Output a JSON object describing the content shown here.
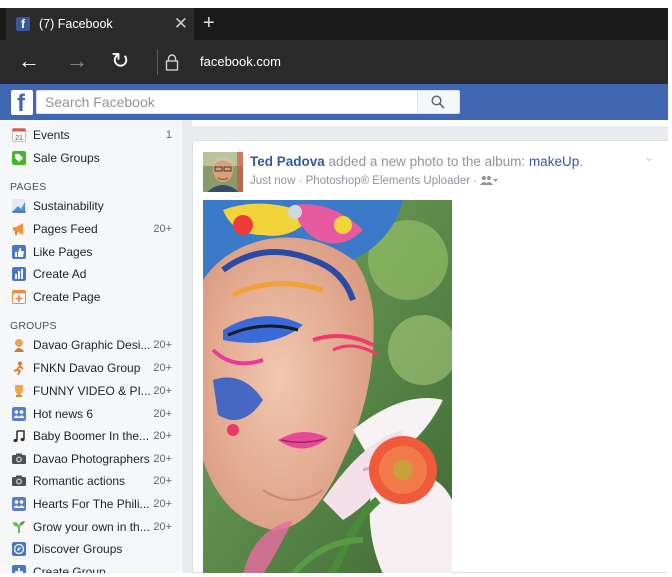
{
  "browser": {
    "tab_title": "(7) Facebook",
    "tab_close": "✕",
    "new_tab": "+",
    "url": "facebook.com",
    "back": "←",
    "forward": "→",
    "refresh": "↻"
  },
  "header": {
    "logo": "f",
    "search_placeholder": "Search Facebook",
    "brand_color": "#4267b2"
  },
  "sidebar": {
    "top_items": [
      {
        "label": "Events",
        "count": "1",
        "icon": "calendar-icon",
        "icon_text": "21"
      },
      {
        "label": "Sale Groups",
        "count": "",
        "icon": "sale-groups-icon"
      }
    ],
    "pages_heading": "PAGES",
    "pages_items": [
      {
        "label": "Sustainability",
        "count": "",
        "icon": "sustainability-icon"
      },
      {
        "label": "Pages Feed",
        "count": "20+",
        "icon": "megaphone-icon"
      },
      {
        "label": "Like Pages",
        "count": "",
        "icon": "thumbs-up-icon"
      },
      {
        "label": "Create Ad",
        "count": "",
        "icon": "bar-chart-icon"
      },
      {
        "label": "Create Page",
        "count": "",
        "icon": "plus-flag-icon"
      }
    ],
    "groups_heading": "GROUPS",
    "groups_items": [
      {
        "label": "Davao Graphic Desi...",
        "count": "20+",
        "icon": "group-avatar-icon"
      },
      {
        "label": "FNKN Davao Group",
        "count": "20+",
        "icon": "figure-icon"
      },
      {
        "label": "FUNNY VIDEO & PI...",
        "count": "20+",
        "icon": "trophy-icon"
      },
      {
        "label": "Hot news 6",
        "count": "20+",
        "icon": "group-people-icon"
      },
      {
        "label": "Baby Boomer In the...",
        "count": "20+",
        "icon": "music-note-icon"
      },
      {
        "label": "Davao Photographers",
        "count": "20+",
        "icon": "camera-icon"
      },
      {
        "label": "Romantic actions",
        "count": "20+",
        "icon": "camera-icon"
      },
      {
        "label": "Hearts For The Phili...",
        "count": "20+",
        "icon": "group-people-icon"
      },
      {
        "label": "Grow your own in th...",
        "count": "20+",
        "icon": "sprout-icon"
      },
      {
        "label": "Discover Groups",
        "count": "",
        "icon": "compass-icon"
      },
      {
        "label": "Create Group",
        "count": "",
        "icon": "create-group-icon"
      }
    ]
  },
  "post": {
    "author": "Ted Padova",
    "action": " added a new photo to the album: ",
    "album": "makeUp",
    "period": ".",
    "time": "Just now",
    "separator": " · ",
    "app": "Photoshop® Elements Uploader",
    "audience_icon": "friends-icon",
    "chevron": "⌄"
  }
}
